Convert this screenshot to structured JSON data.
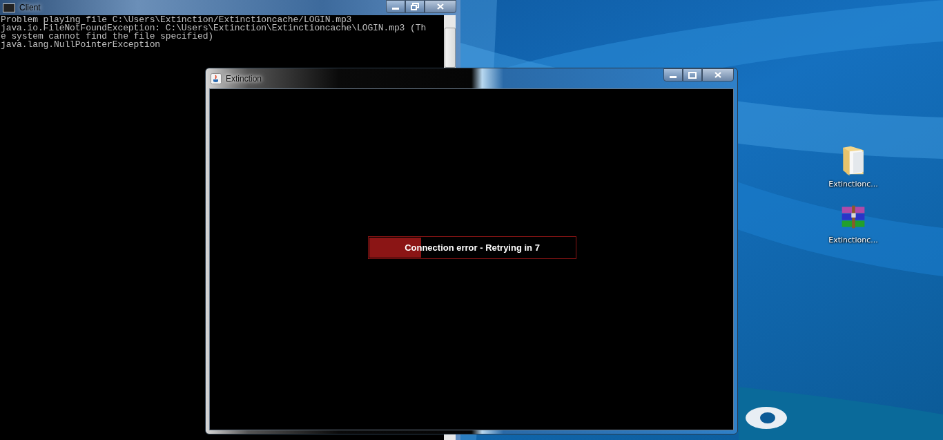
{
  "console_window": {
    "title": "Client",
    "maximized": true,
    "lines": [
      "Problem playing file C:\\Users\\Extinction/Extinctioncache/LOGIN.mp3",
      "java.io.FileNotFoundException: C:\\Users\\Extinction\\Extinctioncache\\LOGIN.mp3 (Th",
      "e system cannot find the file specified)",
      "java.lang.NullPointerException"
    ]
  },
  "game_window": {
    "title": "Extinction",
    "maximized": false,
    "status": {
      "text": "Connection error - Retrying in 7",
      "level": 0.25
    }
  },
  "desktop_icons": [
    {
      "kind": "folder",
      "label": "Extinctionc..."
    },
    {
      "kind": "archive",
      "label": "Extinctionc..."
    }
  ]
}
